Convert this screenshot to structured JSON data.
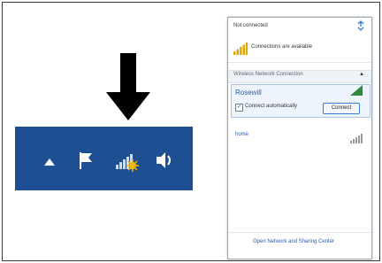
{
  "taskbar": {
    "background": "#1e4f93",
    "icons": [
      "arrow-up-icon",
      "flag-icon",
      "wifi-signal-icon",
      "speaker-icon"
    ]
  },
  "pointer": {
    "icon": "down-arrow-icon",
    "color": "#000000"
  },
  "network_panel": {
    "status": "Not connected",
    "connections_available": "Connections are available",
    "section_label": "Wireless Network Connection",
    "section_arrow": "▲",
    "networks": [
      {
        "name": "Rosewill",
        "selected": true,
        "connect_auto_label": "Connect automatically",
        "connect_auto_checked": true,
        "connect_button": "Connect",
        "signal_color": "#2e8b3e"
      },
      {
        "name": "home",
        "selected": false,
        "signal_color": "#9a9a9a"
      }
    ],
    "footer_link": "Open Network and Sharing Center"
  }
}
